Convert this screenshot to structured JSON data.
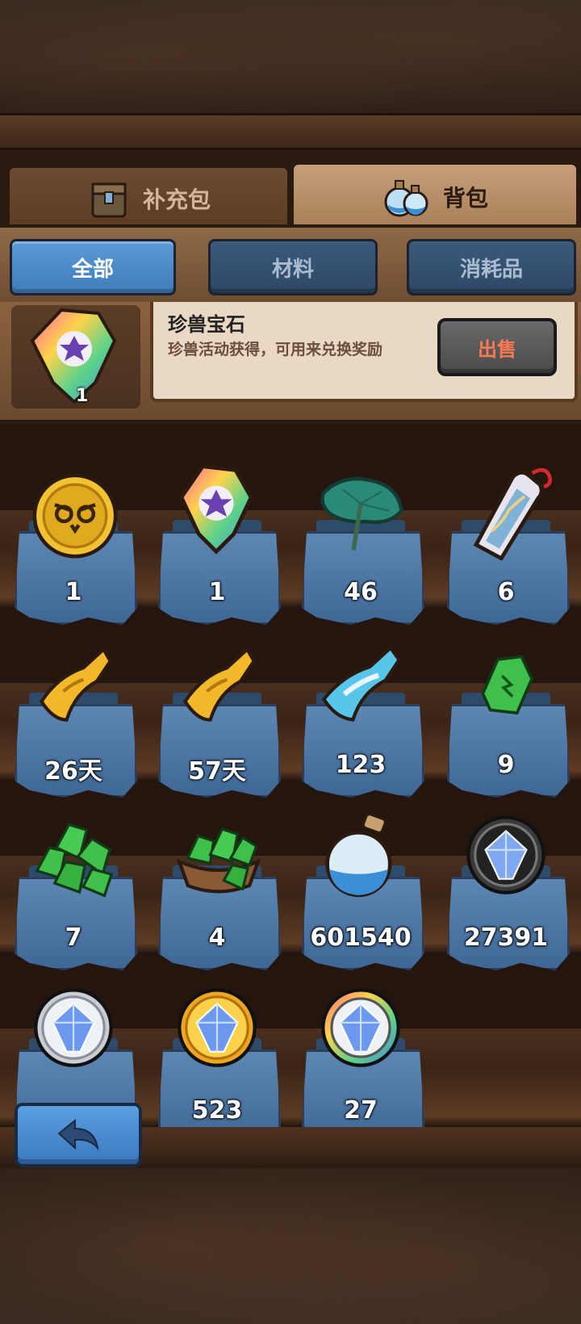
{
  "tabs": [
    {
      "label": "补充包",
      "icon": "chest-icon",
      "active": false
    },
    {
      "label": "背包",
      "icon": "potion-bottles-icon",
      "active": true
    }
  ],
  "filters": [
    {
      "label": "全部",
      "active": true
    },
    {
      "label": "材料",
      "active": false
    },
    {
      "label": "消耗品",
      "active": false
    }
  ],
  "detail": {
    "icon": "rainbow-gem-icon",
    "quantity": "1",
    "title": "珍兽宝石",
    "description": "珍兽活动获得，可用来兑换奖励",
    "sell_label": "出售"
  },
  "items": [
    {
      "icon": "gold-owl-coin-icon",
      "quantity": "1"
    },
    {
      "icon": "rainbow-gem-icon",
      "quantity": "1"
    },
    {
      "icon": "lotus-leaf-icon",
      "quantity": "46"
    },
    {
      "icon": "scroll-tag-icon",
      "quantity": "6"
    },
    {
      "icon": "gold-ticket-icon",
      "quantity": "26天"
    },
    {
      "icon": "gold-ticket-icon",
      "quantity": "57天"
    },
    {
      "icon": "blue-ticket-icon",
      "quantity": "123"
    },
    {
      "icon": "green-crystal-icon",
      "quantity": "9"
    },
    {
      "icon": "green-crystal-pile-icon",
      "quantity": "7"
    },
    {
      "icon": "green-crystal-basket-icon",
      "quantity": "4"
    },
    {
      "icon": "blue-sand-bottle-icon",
      "quantity": "601540"
    },
    {
      "icon": "dark-rune-stone-icon",
      "quantity": "27391"
    },
    {
      "icon": "silver-rune-stone-icon",
      "quantity": ""
    },
    {
      "icon": "gold-rune-stone-icon",
      "quantity": "523"
    },
    {
      "icon": "rainbow-rune-stone-icon",
      "quantity": "27"
    }
  ],
  "back_button_icon": "back-arrow-icon"
}
